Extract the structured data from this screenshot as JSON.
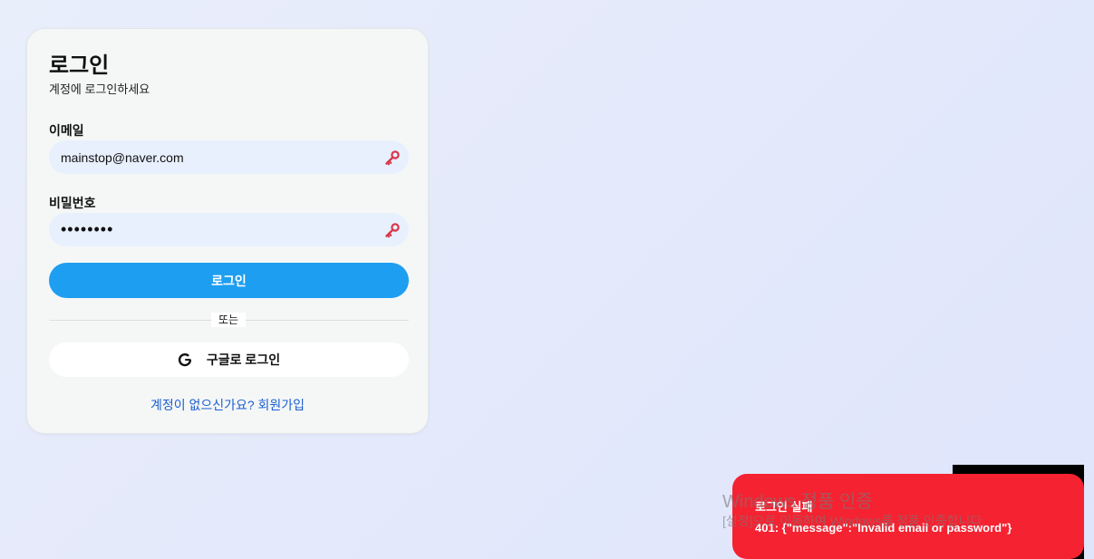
{
  "login": {
    "title": "로그인",
    "subtitle": "계정에 로그인하세요",
    "email_label": "이메일",
    "email_value": "mainstop@naver.com",
    "password_label": "비밀번호",
    "password_value": "12345678",
    "submit_label": "로그인",
    "divider_text": "또는",
    "google_label": "구글로 로그인",
    "signup_text": "계정이 없으신가요? 회원가입"
  },
  "toast": {
    "title": "로그인 실패",
    "message": "401: {\"message\":\"Invalid email or password\"}"
  },
  "watermark": {
    "title": "Windows 정품 인증",
    "subtitle": "[설정]으로 이동하여 Windows를 정품 인증합니다."
  },
  "colors": {
    "primary": "#1e9ef0",
    "error": "#f52231",
    "link": "#1c5fd0",
    "input_bg": "#e8f0fe"
  }
}
